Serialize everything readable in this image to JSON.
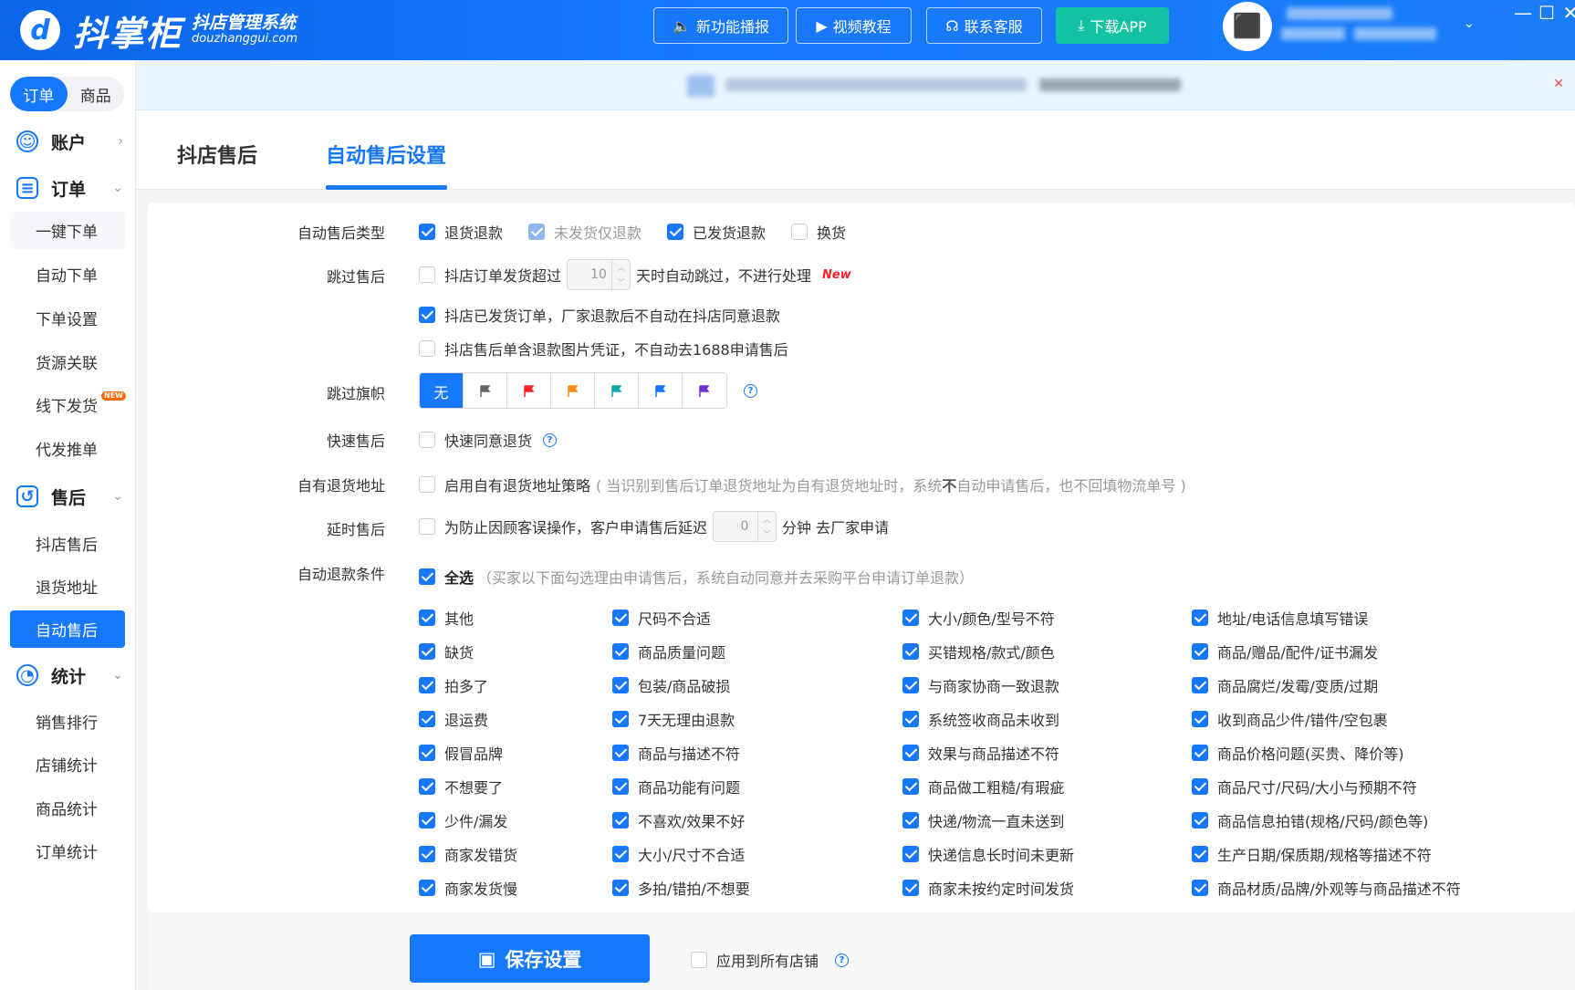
{
  "header": {
    "logo_mark": "d",
    "brand_name": "抖掌柜",
    "brand_tagline": "抖店管理系统",
    "brand_domain": "douzhanggui.com",
    "buttons": [
      {
        "label": "新功能播报",
        "icon": "speaker-icon"
      },
      {
        "label": "视频教程",
        "icon": "video-icon"
      },
      {
        "label": "联系客服",
        "icon": "headset-icon"
      },
      {
        "label": "下载APP",
        "icon": "download-icon"
      }
    ],
    "window_controls": [
      "—",
      "☐",
      "✕"
    ]
  },
  "sidebar": {
    "segment": {
      "items": [
        "订单",
        "商品"
      ],
      "active": "订单"
    },
    "groups": [
      {
        "label": "账户",
        "icon": "smile-icon",
        "expanded": false,
        "items": []
      },
      {
        "label": "订单",
        "icon": "list-icon",
        "expanded": true,
        "items": [
          "一键下单",
          "自动下单",
          "下单设置",
          "货源关联",
          "线下发货",
          "代发推单"
        ]
      },
      {
        "label": "售后",
        "icon": "return-icon",
        "expanded": true,
        "items": [
          "抖店售后",
          "退货地址",
          "自动售后"
        ]
      },
      {
        "label": "统计",
        "icon": "pie-chart-icon",
        "expanded": true,
        "items": [
          "销售排行",
          "店铺统计",
          "商品统计",
          "订单统计"
        ]
      }
    ],
    "new_badge": "NEW",
    "active_item": "自动售后"
  },
  "tabs": [
    {
      "label": "抖店售后",
      "active": false
    },
    {
      "label": "自动售后设置",
      "active": true
    }
  ],
  "form": {
    "type": {
      "label": "自动售后类型",
      "options": [
        {
          "label": "退货退款",
          "checked": true,
          "disabled": false
        },
        {
          "label": "未发货仅退款",
          "checked": true,
          "disabled": true
        },
        {
          "label": "已发货退款",
          "checked": true,
          "disabled": false
        },
        {
          "label": "换货",
          "checked": false,
          "disabled": false
        }
      ]
    },
    "skip": {
      "label": "跳过售后",
      "opt1_prefix": "抖店订单发货超过",
      "opt1_days": "10",
      "opt1_suffix": "天时自动跳过，不进行处理",
      "opt1_new": "New",
      "opt1_checked": false,
      "opt2": "抖店已发货订单，厂家退款后不自动在抖店同意退款",
      "opt2_checked": true,
      "opt3": "抖店售后单含退款图片凭证，不自动去1688申请售后",
      "opt3_checked": false
    },
    "flags": {
      "label": "跳过旗帜",
      "none_label": "无",
      "colors": [
        "#666666",
        "#f5222d",
        "#fa8c16",
        "#13a8a8",
        "#1677ff",
        "#722ed1"
      ]
    },
    "quick": {
      "label": "快速售后",
      "option": "快速同意退货",
      "checked": false
    },
    "own_address": {
      "label": "自有退货地址",
      "option": "启用自有退货地址策略",
      "hint_prefix": "( 当识别到售后订单退货地址为自有退货地址时，系统",
      "hint_bold": "不",
      "hint_suffix": "自动申请售后，也不回填物流单号 )",
      "checked": false
    },
    "delay": {
      "label": "延时售后",
      "prefix": "为防止因顾客误操作，客户申请售后延迟",
      "minutes": "0",
      "suffix": "分钟 去厂家申请",
      "checked": false
    },
    "conditions": {
      "label": "自动退款条件",
      "select_all": "全选",
      "select_all_hint": "（买家以下面勾选理由申请售后，系统自动同意并去采购平台申请订单退款）",
      "columns": [
        [
          "其他",
          "缺货",
          "拍多了",
          "退运费",
          "假冒品牌",
          "不想要了",
          "少件/漏发",
          "商家发错货",
          "商家发货慢"
        ],
        [
          "尺码不合适",
          "商品质量问题",
          "包装/商品破损",
          "7天无理由退款",
          "商品与描述不符",
          "商品功能有问题",
          "不喜欢/效果不好",
          "大小/尺寸不合适",
          "多拍/错拍/不想要"
        ],
        [
          "大小/颜色/型号不符",
          "买错规格/款式/颜色",
          "与商家协商一致退款",
          "系统签收商品未收到",
          "效果与商品描述不符",
          "商品做工粗糙/有瑕疵",
          "快递/物流一直未送到",
          "快递信息长时间未更新",
          "商家未按约定时间发货"
        ],
        [
          "地址/电话信息填写错误",
          "商品/赠品/配件/证书漏发",
          "商品腐烂/发霉/变质/过期",
          "收到商品少件/错件/空包裹",
          "商品价格问题(买贵、降价等)",
          "商品尺寸/尺码/大小与预期不符",
          "商品信息拍错(规格/尺码/颜色等)",
          "生产日期/保质期/规格等描述不符",
          "商品材质/品牌/外观等与商品描述不符"
        ]
      ]
    }
  },
  "footer": {
    "save_label": "保存设置",
    "apply_all_label": "应用到所有店铺",
    "apply_all_checked": false
  }
}
